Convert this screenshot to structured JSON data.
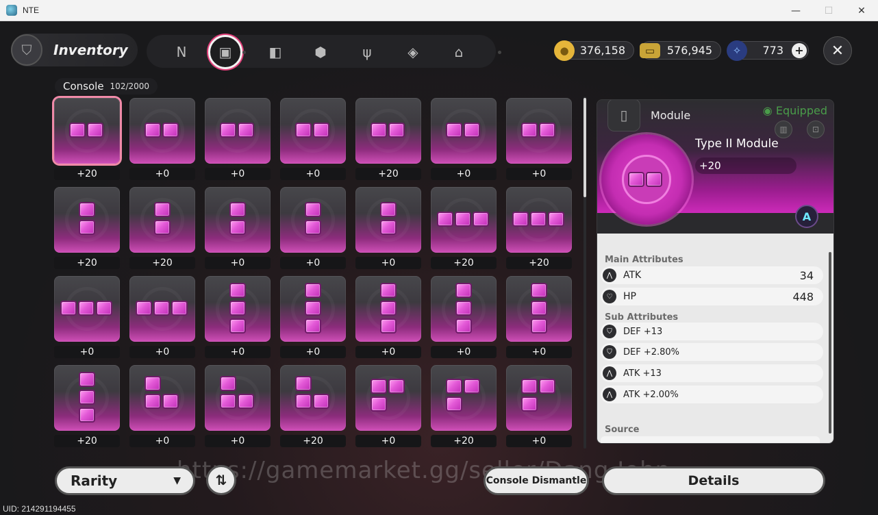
{
  "window": {
    "title": "NTE",
    "minimize": "—",
    "maximize": "☐",
    "close": "✕"
  },
  "header": {
    "title": "Inventory",
    "tabs": [
      {
        "name": "tab-n",
        "icon": "n-logo-icon",
        "glyph": "N"
      },
      {
        "name": "tab-console",
        "icon": "gameboy-icon",
        "glyph": "▣",
        "active": true
      },
      {
        "name": "tab-cards",
        "icon": "cards-icon",
        "glyph": "◧"
      },
      {
        "name": "tab-box",
        "icon": "box-icon",
        "glyph": "⬢"
      },
      {
        "name": "tab-food",
        "icon": "utensils-icon",
        "glyph": "ψ"
      },
      {
        "name": "tab-map",
        "icon": "compass-icon",
        "glyph": "◈"
      },
      {
        "name": "tab-home",
        "icon": "house-icon",
        "glyph": "⌂"
      }
    ]
  },
  "currencies": [
    {
      "name": "gold-currency",
      "icon": "gold-coin-icon",
      "value": "376,158",
      "color": "#e5b53a"
    },
    {
      "name": "ticket-currency",
      "icon": "ticket-icon",
      "value": "576,945",
      "color": "#c9a437"
    },
    {
      "name": "crystal-currency",
      "icon": "crystal-icon",
      "value": "773",
      "color": "#4a7ee0"
    }
  ],
  "grid": {
    "label": "Console",
    "count": "102/2000",
    "items": [
      {
        "shape": "h2",
        "level": "+20",
        "selected": true
      },
      {
        "shape": "h2",
        "level": "+0"
      },
      {
        "shape": "h2",
        "level": "+0"
      },
      {
        "shape": "h2",
        "level": "+0"
      },
      {
        "shape": "h2",
        "level": "+20"
      },
      {
        "shape": "h2",
        "level": "+0"
      },
      {
        "shape": "h2",
        "level": "+0"
      },
      {
        "shape": "v2",
        "level": "+20"
      },
      {
        "shape": "v2",
        "level": "+20"
      },
      {
        "shape": "v2",
        "level": "+0"
      },
      {
        "shape": "v2",
        "level": "+0"
      },
      {
        "shape": "v2",
        "level": "+0"
      },
      {
        "shape": "h3",
        "level": "+20"
      },
      {
        "shape": "h3",
        "level": "+20"
      },
      {
        "shape": "h3",
        "level": "+0"
      },
      {
        "shape": "h3",
        "level": "+0"
      },
      {
        "shape": "v3",
        "level": "+0"
      },
      {
        "shape": "v3",
        "level": "+0"
      },
      {
        "shape": "v3",
        "level": "+0"
      },
      {
        "shape": "v3",
        "level": "+0"
      },
      {
        "shape": "v3",
        "level": "+0"
      },
      {
        "shape": "v3",
        "level": "+20"
      },
      {
        "shape": "L",
        "level": "+0"
      },
      {
        "shape": "L",
        "level": "+0"
      },
      {
        "shape": "L",
        "level": "+20"
      },
      {
        "shape": "J",
        "level": "+0"
      },
      {
        "shape": "J",
        "level": "+20"
      },
      {
        "shape": "J",
        "level": "+0"
      }
    ]
  },
  "panel": {
    "header_label": "Module",
    "equipped": "Equipped",
    "item_name": "Type II Module",
    "item_level": "+20",
    "rank": "A",
    "main_title": "Main Attributes",
    "main_attrs": [
      {
        "icon": "atk-icon",
        "name": "ATK",
        "value": "34"
      },
      {
        "icon": "hp-icon",
        "name": "HP",
        "value": "448"
      }
    ],
    "sub_title": "Sub Attributes",
    "sub_attrs": [
      {
        "icon": "def-icon",
        "name": "DEF +13"
      },
      {
        "icon": "def-icon",
        "name": "DEF +2.80%"
      },
      {
        "icon": "atk-icon",
        "name": "ATK +13"
      },
      {
        "icon": "atk-icon",
        "name": "ATK +2.00%"
      }
    ],
    "source_title": "Source"
  },
  "footer": {
    "rarity": "Rarity",
    "sort": "⇅",
    "dismantle": "Console Dismantle",
    "details": "Details",
    "uid": "UID: 214291194455",
    "watermark": "https://gamemarket.gg/seller/Dang.John"
  }
}
